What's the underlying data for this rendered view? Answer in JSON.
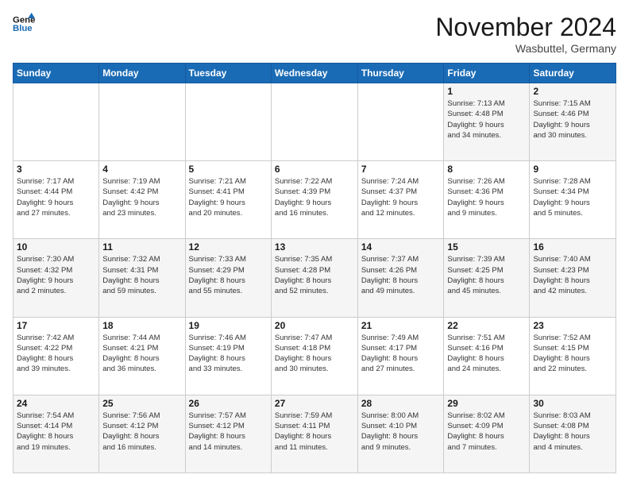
{
  "logo": {
    "line1": "General",
    "line2": "Blue"
  },
  "header": {
    "title": "November 2024",
    "location": "Wasbuttel, Germany"
  },
  "weekdays": [
    "Sunday",
    "Monday",
    "Tuesday",
    "Wednesday",
    "Thursday",
    "Friday",
    "Saturday"
  ],
  "weeks": [
    [
      {
        "day": "",
        "info": ""
      },
      {
        "day": "",
        "info": ""
      },
      {
        "day": "",
        "info": ""
      },
      {
        "day": "",
        "info": ""
      },
      {
        "day": "",
        "info": ""
      },
      {
        "day": "1",
        "info": "Sunrise: 7:13 AM\nSunset: 4:48 PM\nDaylight: 9 hours\nand 34 minutes."
      },
      {
        "day": "2",
        "info": "Sunrise: 7:15 AM\nSunset: 4:46 PM\nDaylight: 9 hours\nand 30 minutes."
      }
    ],
    [
      {
        "day": "3",
        "info": "Sunrise: 7:17 AM\nSunset: 4:44 PM\nDaylight: 9 hours\nand 27 minutes."
      },
      {
        "day": "4",
        "info": "Sunrise: 7:19 AM\nSunset: 4:42 PM\nDaylight: 9 hours\nand 23 minutes."
      },
      {
        "day": "5",
        "info": "Sunrise: 7:21 AM\nSunset: 4:41 PM\nDaylight: 9 hours\nand 20 minutes."
      },
      {
        "day": "6",
        "info": "Sunrise: 7:22 AM\nSunset: 4:39 PM\nDaylight: 9 hours\nand 16 minutes."
      },
      {
        "day": "7",
        "info": "Sunrise: 7:24 AM\nSunset: 4:37 PM\nDaylight: 9 hours\nand 12 minutes."
      },
      {
        "day": "8",
        "info": "Sunrise: 7:26 AM\nSunset: 4:36 PM\nDaylight: 9 hours\nand 9 minutes."
      },
      {
        "day": "9",
        "info": "Sunrise: 7:28 AM\nSunset: 4:34 PM\nDaylight: 9 hours\nand 5 minutes."
      }
    ],
    [
      {
        "day": "10",
        "info": "Sunrise: 7:30 AM\nSunset: 4:32 PM\nDaylight: 9 hours\nand 2 minutes."
      },
      {
        "day": "11",
        "info": "Sunrise: 7:32 AM\nSunset: 4:31 PM\nDaylight: 8 hours\nand 59 minutes."
      },
      {
        "day": "12",
        "info": "Sunrise: 7:33 AM\nSunset: 4:29 PM\nDaylight: 8 hours\nand 55 minutes."
      },
      {
        "day": "13",
        "info": "Sunrise: 7:35 AM\nSunset: 4:28 PM\nDaylight: 8 hours\nand 52 minutes."
      },
      {
        "day": "14",
        "info": "Sunrise: 7:37 AM\nSunset: 4:26 PM\nDaylight: 8 hours\nand 49 minutes."
      },
      {
        "day": "15",
        "info": "Sunrise: 7:39 AM\nSunset: 4:25 PM\nDaylight: 8 hours\nand 45 minutes."
      },
      {
        "day": "16",
        "info": "Sunrise: 7:40 AM\nSunset: 4:23 PM\nDaylight: 8 hours\nand 42 minutes."
      }
    ],
    [
      {
        "day": "17",
        "info": "Sunrise: 7:42 AM\nSunset: 4:22 PM\nDaylight: 8 hours\nand 39 minutes."
      },
      {
        "day": "18",
        "info": "Sunrise: 7:44 AM\nSunset: 4:21 PM\nDaylight: 8 hours\nand 36 minutes."
      },
      {
        "day": "19",
        "info": "Sunrise: 7:46 AM\nSunset: 4:19 PM\nDaylight: 8 hours\nand 33 minutes."
      },
      {
        "day": "20",
        "info": "Sunrise: 7:47 AM\nSunset: 4:18 PM\nDaylight: 8 hours\nand 30 minutes."
      },
      {
        "day": "21",
        "info": "Sunrise: 7:49 AM\nSunset: 4:17 PM\nDaylight: 8 hours\nand 27 minutes."
      },
      {
        "day": "22",
        "info": "Sunrise: 7:51 AM\nSunset: 4:16 PM\nDaylight: 8 hours\nand 24 minutes."
      },
      {
        "day": "23",
        "info": "Sunrise: 7:52 AM\nSunset: 4:15 PM\nDaylight: 8 hours\nand 22 minutes."
      }
    ],
    [
      {
        "day": "24",
        "info": "Sunrise: 7:54 AM\nSunset: 4:14 PM\nDaylight: 8 hours\nand 19 minutes."
      },
      {
        "day": "25",
        "info": "Sunrise: 7:56 AM\nSunset: 4:12 PM\nDaylight: 8 hours\nand 16 minutes."
      },
      {
        "day": "26",
        "info": "Sunrise: 7:57 AM\nSunset: 4:12 PM\nDaylight: 8 hours\nand 14 minutes."
      },
      {
        "day": "27",
        "info": "Sunrise: 7:59 AM\nSunset: 4:11 PM\nDaylight: 8 hours\nand 11 minutes."
      },
      {
        "day": "28",
        "info": "Sunrise: 8:00 AM\nSunset: 4:10 PM\nDaylight: 8 hours\nand 9 minutes."
      },
      {
        "day": "29",
        "info": "Sunrise: 8:02 AM\nSunset: 4:09 PM\nDaylight: 8 hours\nand 7 minutes."
      },
      {
        "day": "30",
        "info": "Sunrise: 8:03 AM\nSunset: 4:08 PM\nDaylight: 8 hours\nand 4 minutes."
      }
    ]
  ]
}
